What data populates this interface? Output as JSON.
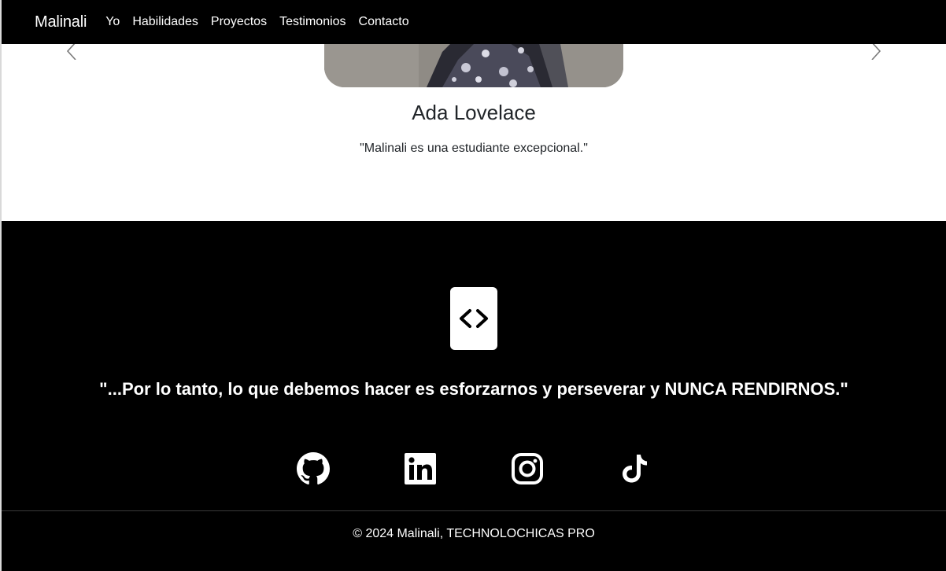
{
  "navbar": {
    "brand": "Malinali",
    "links": [
      {
        "label": "Yo"
      },
      {
        "label": "Habilidades"
      },
      {
        "label": "Proyectos"
      },
      {
        "label": "Testimonios"
      },
      {
        "label": "Contacto"
      }
    ]
  },
  "testimonial": {
    "name": "Ada Lovelace",
    "quote": "\"Malinali es una estudiante excepcional.\"",
    "prev_icon": "chevron-left-icon",
    "next_icon": "chevron-right-icon"
  },
  "footer": {
    "logo_icon": "code-brackets-icon",
    "motto": "\"...Por lo tanto, lo que debemos hacer es esforzarnos y perseverar y NUNCA RENDIRNOS.\"",
    "socials": [
      {
        "name": "github",
        "icon": "github-icon"
      },
      {
        "name": "linkedin",
        "icon": "linkedin-icon"
      },
      {
        "name": "instagram",
        "icon": "instagram-icon"
      },
      {
        "name": "tiktok",
        "icon": "tiktok-icon"
      }
    ],
    "copyright": "© 2024 Malinali, TECHNOLOCHICAS PRO"
  },
  "colors": {
    "nav_bg": "#000000",
    "footer_bg": "#000000",
    "section_bg": "#ffffff",
    "text_dark": "#212529"
  }
}
